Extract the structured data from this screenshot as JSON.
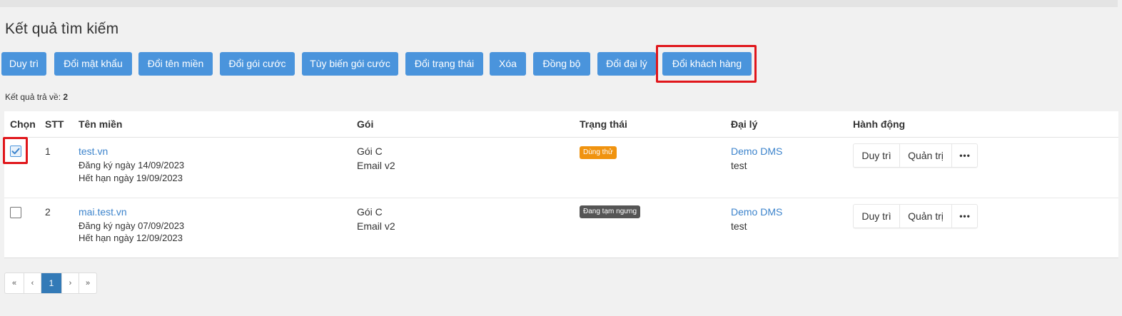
{
  "title": "Kết quả tìm kiếm",
  "toolbar": {
    "buttons": [
      "Duy trì",
      "Đổi mật khẩu",
      "Đổi tên miền",
      "Đổi gói cước",
      "Tùy biến gói cước",
      "Đổi trạng thái",
      "Xóa",
      "Đồng bộ",
      "Đổi đại lý",
      "Đổi khách hàng"
    ]
  },
  "result": {
    "label": "Kết quả trả về:",
    "count": "2"
  },
  "table": {
    "headers": [
      "Chọn",
      "STT",
      "Tên miền",
      "Gói",
      "Trạng thái",
      "Đại lý",
      "Hành động"
    ],
    "rows": [
      {
        "checked": true,
        "stt": "1",
        "domain": "test.vn",
        "registered": "Đăng ký ngày 14/09/2023",
        "expires": "Hết hạn ngày 19/09/2023",
        "package": "Gói C",
        "package_type": "Email v2",
        "status": "Dùng thử",
        "status_color": "#f0930f",
        "agent": "Demo DMS",
        "agent_user": "test",
        "actions": [
          "Duy trì",
          "Quản trị",
          "•••"
        ]
      },
      {
        "checked": false,
        "stt": "2",
        "domain": "mai.test.vn",
        "registered": "Đăng ký ngày 07/09/2023",
        "expires": "Hết hạn ngày 12/09/2023",
        "package": "Gói C",
        "package_type": "Email v2",
        "status": "Đang tạm ngưng",
        "status_color": "#555555",
        "agent": "Demo DMS",
        "agent_user": "test",
        "actions": [
          "Duy trì",
          "Quản trị",
          "•••"
        ]
      }
    ]
  },
  "pagination": {
    "first": "«",
    "prev": "‹",
    "current": "1",
    "next": "›",
    "last": "»"
  },
  "colors": {
    "primary_button": "#4a94dc",
    "highlight": "#e0161b",
    "link": "#3d84cc",
    "page_active": "#337ab7"
  }
}
